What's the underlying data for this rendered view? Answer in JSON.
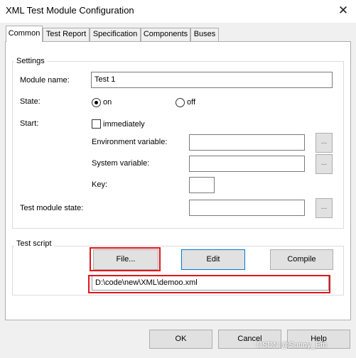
{
  "window": {
    "title": "XML Test Module Configuration",
    "close_glyph": "✕"
  },
  "tabs": [
    {
      "label": "Common",
      "active": true
    },
    {
      "label": "Test Report"
    },
    {
      "label": "Specification"
    },
    {
      "label": "Components"
    },
    {
      "label": "Buses"
    }
  ],
  "settings": {
    "legend": "Settings",
    "module_name_label": "Module name:",
    "module_name_value": "Test 1",
    "state_label": "State:",
    "state_on": "on",
    "state_off": "off",
    "state_selected": "on",
    "start_label": "Start:",
    "immediately_label": "immediately",
    "immediately_checked": false,
    "env_var_label": "Environment variable:",
    "env_var_value": "",
    "sys_var_label": "System variable:",
    "sys_var_value": "",
    "key_label": "Key:",
    "key_value": "",
    "module_state_label": "Test module state:",
    "module_state_value": "",
    "ellipsis": "..."
  },
  "test_script": {
    "legend": "Test script",
    "file_label": "File...",
    "edit_label": "Edit",
    "compile_label": "Compile",
    "path_value": "D:\\code\\new\\XML\\demoo.xml"
  },
  "footer": {
    "ok_label": "OK",
    "cancel_label": "Cancel",
    "help_label": "Help"
  },
  "watermark": "CSDN @Sunny_Eth",
  "colors": {
    "highlight_red": "#e0161b",
    "focus_blue": "#0078d7"
  }
}
